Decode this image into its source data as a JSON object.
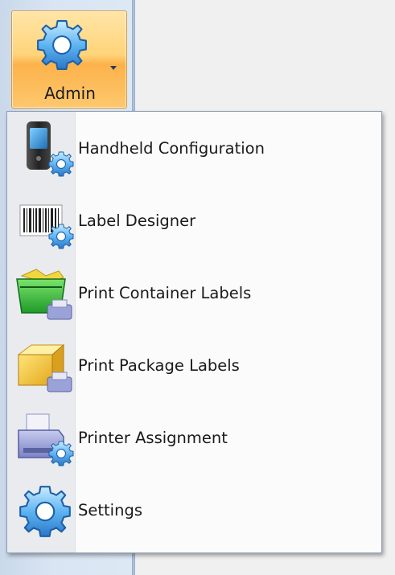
{
  "ribbon": {
    "admin_button": {
      "label": "Admin",
      "icon": "gear-icon"
    }
  },
  "menu": {
    "items": [
      {
        "label": "Handheld Configuration",
        "icon": "handheld-gear-icon"
      },
      {
        "label": "Label Designer",
        "icon": "barcode-gear-icon"
      },
      {
        "label": "Print Container Labels",
        "icon": "green-container-printer-icon"
      },
      {
        "label": "Print Package Labels",
        "icon": "yellow-package-printer-icon"
      },
      {
        "label": "Printer Assignment",
        "icon": "printer-gear-icon"
      },
      {
        "label": "Settings",
        "icon": "gear-icon"
      }
    ]
  },
  "colors": {
    "ribbon_button_top": "#ffe5a8",
    "ribbon_button_bottom": "#fcb24b",
    "menu_border": "#8c9fb9",
    "gear_blue": "#3f8fd8"
  }
}
